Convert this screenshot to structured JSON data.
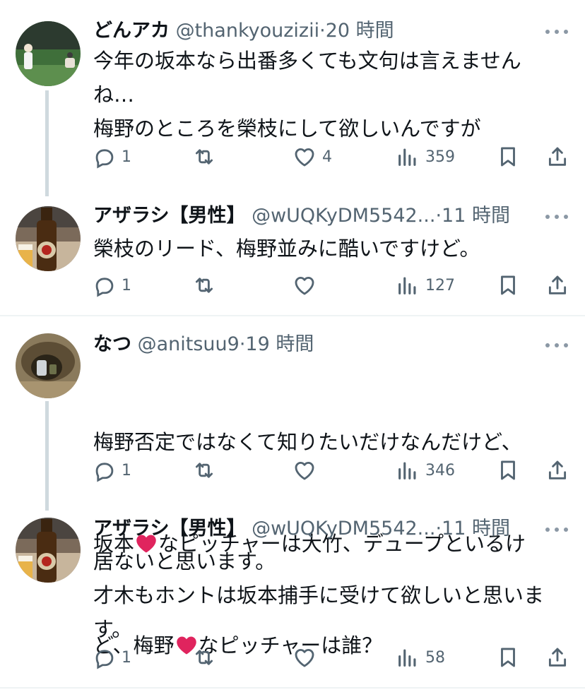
{
  "colors": {
    "text": "#0f1419",
    "secondary": "#536471",
    "thread_line": "#cfd9de",
    "divider": "#eff3f4",
    "heart_emoji": "#e0245e"
  },
  "tweets": [
    {
      "name": "どんアカ",
      "handle": "@thankyouzizii",
      "dot": "·",
      "time": "20 時間",
      "text": "今年の坂本なら出番多くても文句は言えません\nね…\n梅野のところを榮枝にして欲しいんですが",
      "replies": "1",
      "reposts": "",
      "likes": "4",
      "views": "359",
      "avatar": "baseball-player-avatar"
    },
    {
      "name": "アザラシ【男性】",
      "handle": "@wUQKyDM5542...",
      "dot": "·",
      "time": "11 時間",
      "text": "榮枝のリード、梅野並みに酷いですけど。",
      "replies": "1",
      "reposts": "",
      "likes": "",
      "views": "127",
      "avatar": "beer-bottle-avatar"
    },
    {
      "name": "なつ",
      "handle": "@anitsuu9",
      "dot": "·",
      "time": "19 時間",
      "text_line1": "梅野否定ではなくて知りたいだけなんだけど、",
      "text_line2a": "坂本",
      "text_line2b": "なピッチャーは大竹、デュープといるけ",
      "text_line3a": "ど、梅野",
      "text_line3b": "なピッチャーは誰？",
      "replies": "1",
      "reposts": "",
      "likes": "",
      "views": "346",
      "avatar": "cave-photo-avatar"
    },
    {
      "name": "アザラシ【男性】",
      "handle": "@wUQKyDM5542...",
      "dot": "·",
      "time": "11 時間",
      "text": "居ないと思います。\n才木もホントは坂本捕手に受けて欲しいと思いま\nす。",
      "replies": "1",
      "reposts": "",
      "likes": "",
      "views": "58",
      "avatar": "beer-bottle-avatar"
    }
  ]
}
